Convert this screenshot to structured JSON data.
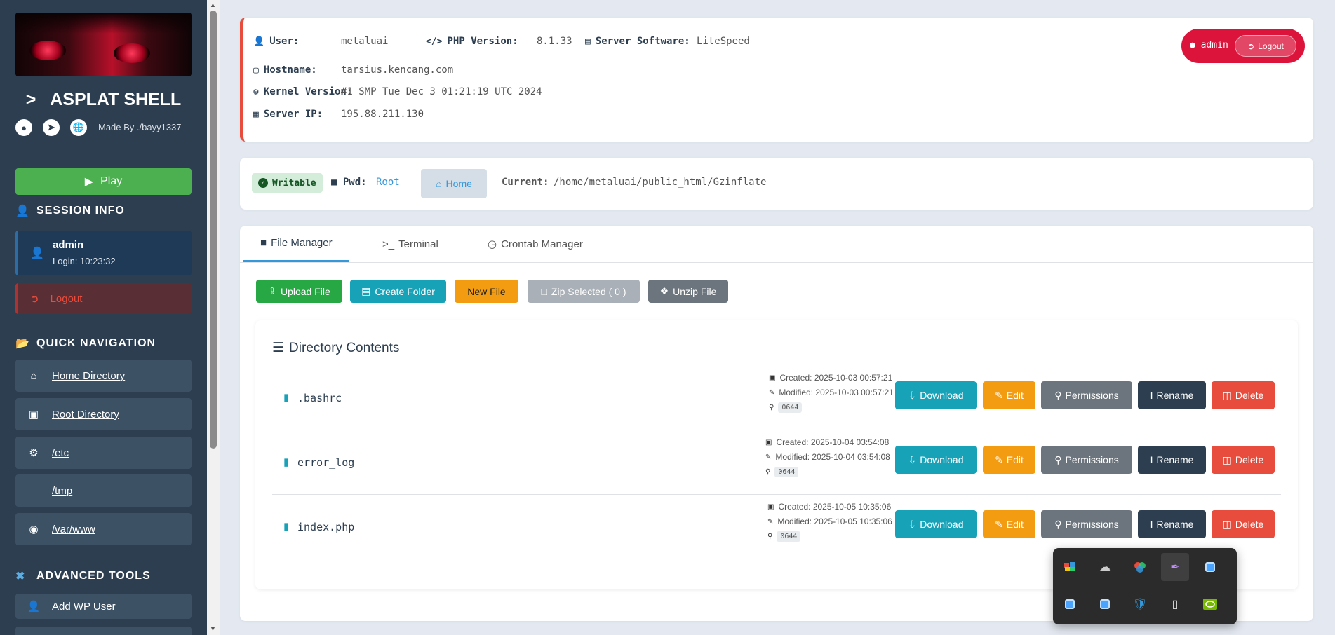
{
  "sidebar": {
    "app_title": "ASPLAT SHELL",
    "app_title_icon": "terminal-icon",
    "made_by": "Made By ./bayy1337",
    "social_icons": [
      "github-icon",
      "telegram-icon",
      "globe-icon"
    ],
    "play_label": "Play",
    "session_heading": "SESSION INFO",
    "session_user": "admin",
    "session_login": "Login: 10:23:32",
    "logout_label": "Logout",
    "quick_nav_heading": "QUICK NAVIGATION",
    "nav_items": [
      {
        "label": "Home Directory",
        "icon": "home-icon"
      },
      {
        "label": "Root Directory",
        "icon": "hdd-icon"
      },
      {
        "label": "/etc",
        "icon": "cogs-icon"
      },
      {
        "label": "/tmp",
        "icon": "folder-icon"
      },
      {
        "label": "/var/www",
        "icon": "globe-icon"
      }
    ],
    "advanced_heading": "ADVANCED TOOLS",
    "advanced_items": [
      {
        "label": "Add WP User",
        "icon": "user-plus-icon"
      }
    ]
  },
  "server_info": {
    "user_label": "User:",
    "user_value": "metaluai",
    "php_label": "PHP Version:",
    "php_value": "8.1.33",
    "software_label": "Server Software:",
    "software_value": "LiteSpeed",
    "hostname_label": "Hostname:",
    "hostname_value": "tarsius.kencang.com",
    "kernel_label": "Kernel Version:",
    "kernel_value": "#1 SMP Tue Dec 3 01:21:19 UTC 2024",
    "ip_label": "Server IP:",
    "ip_value": "195.88.211.130",
    "badge_user": "admin",
    "badge_logout": "Logout"
  },
  "path_bar": {
    "writable": "Writable",
    "pwd_label": "Pwd:",
    "pwd_value": "Root",
    "home_label": "Home",
    "current_label": "Current:",
    "current_path": "/home/metaluai/public_html/Gzinflate"
  },
  "tabs": [
    {
      "label": "File Manager",
      "active": true
    },
    {
      "label": "Terminal",
      "active": false
    },
    {
      "label": "Crontab Manager",
      "active": false
    }
  ],
  "toolbar": {
    "upload": "Upload File",
    "create_folder": "Create Folder",
    "new_file": "New File",
    "zip_selected": "Zip Selected ( 0 )",
    "unzip": "Unzip File"
  },
  "directory": {
    "title": "Directory Contents",
    "action_labels": {
      "download": "Download",
      "edit": "Edit",
      "permissions": "Permissions",
      "rename": "Rename",
      "delete": "Delete"
    },
    "files": [
      {
        "name": ".bashrc",
        "created": "Created: 2025-10-03 00:57:21",
        "modified": "Modified: 2025-10-03 00:57:21",
        "perms": "0644"
      },
      {
        "name": "error_log",
        "created": "Created: 2025-10-04 03:54:08",
        "modified": "Modified: 2025-10-04 03:54:08",
        "perms": "0644"
      },
      {
        "name": "index.php",
        "created": "Created: 2025-10-05 10:35:06",
        "modified": "Modified: 2025-10-05 10:35:06",
        "perms": "0644"
      }
    ]
  },
  "tray_icons": [
    "photos-app-icon",
    "onedrive-offline-icon",
    "color-app-icon",
    "feather-app-icon",
    "app-window-icon",
    "app-window-icon",
    "app-window-icon",
    "defender-warning-icon",
    "usb-drive-icon",
    "nvidia-icon"
  ],
  "colors": {
    "sidebar_bg": "#2c3e50",
    "accent_blue": "#3498db",
    "success": "#28a745",
    "info": "#17a2b8",
    "warning": "#f39c12",
    "danger": "#e74c3c",
    "badge_red": "#dc143c"
  }
}
